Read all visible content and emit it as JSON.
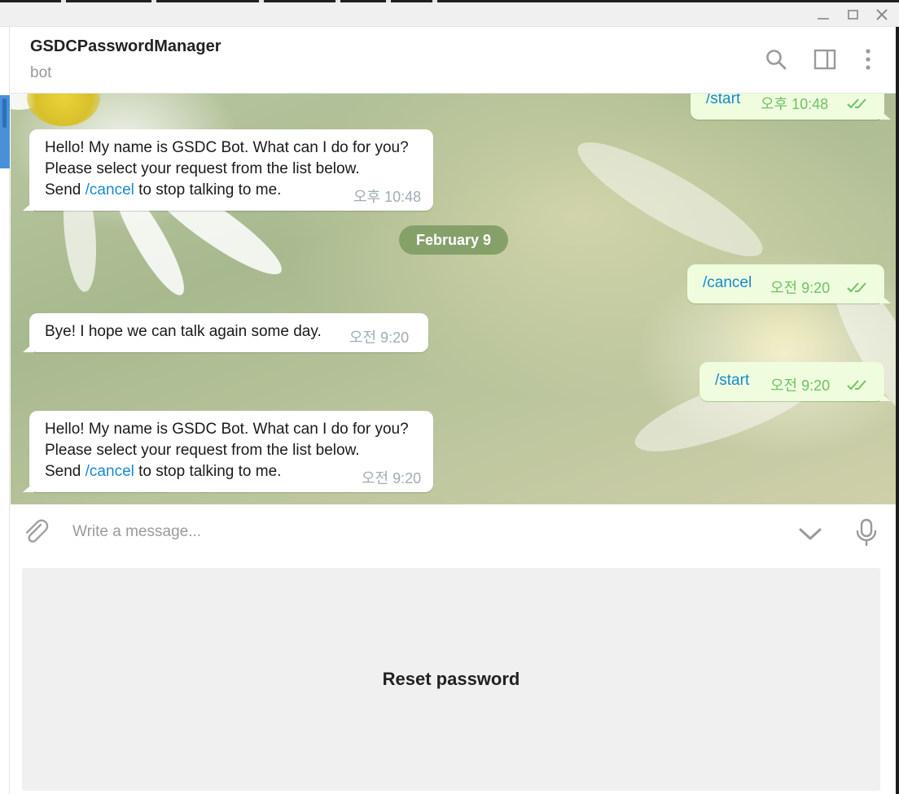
{
  "window": {
    "controls": [
      "minimize",
      "maximize",
      "close"
    ]
  },
  "header": {
    "peer_name": "GSDCPasswordManager",
    "peer_status": "bot",
    "icons": [
      "search-icon",
      "side-panel-icon",
      "more-vertical-icon"
    ]
  },
  "history": {
    "messages": [
      {
        "direction": "out",
        "text": "/start",
        "time": "오후 10:48",
        "read": true
      },
      {
        "direction": "in",
        "lines": [
          "Hello! My name is GSDC Bot. What can I do for you?",
          "Please select your request from the list below."
        ],
        "send_prefix": "Send ",
        "send_link": "/cancel",
        "send_suffix": " to stop talking to me.",
        "time": "오후 10:48"
      },
      {
        "direction": "out",
        "text": "/cancel",
        "time": "오전 9:20",
        "read": true
      },
      {
        "direction": "in",
        "text": "Bye! I hope we can talk again some day.",
        "time": "오전 9:20"
      },
      {
        "direction": "out",
        "text": "/start",
        "time": "오전 9:20",
        "read": true
      },
      {
        "direction": "in",
        "lines": [
          "Hello! My name is GSDC Bot. What can I do for you?",
          "Please select your request from the list below."
        ],
        "send_prefix": "Send ",
        "send_link": "/cancel",
        "send_suffix": " to stop talking to me.",
        "time": "오전 9:20"
      }
    ],
    "date_separator": "February 9"
  },
  "compose": {
    "placeholder": "Write a message...",
    "icons": [
      "paperclip-icon",
      "chevron-down-icon",
      "microphone-icon"
    ]
  },
  "bot_keyboard": {
    "buttons": [
      "Reset password"
    ]
  },
  "colors": {
    "incoming_bubble": "#ffffff",
    "outgoing_bubble": "#effdde",
    "link": "#168acd",
    "outgoing_time": "#6cc264",
    "date_pill": "#86a06a"
  }
}
